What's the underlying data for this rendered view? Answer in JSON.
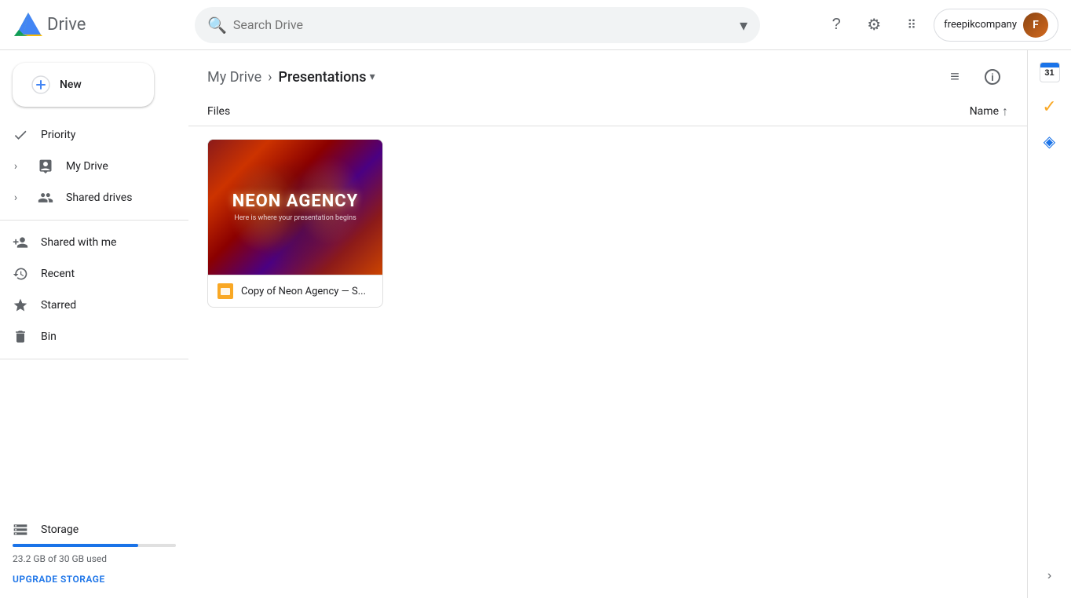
{
  "header": {
    "logo_text": "Drive",
    "search_placeholder": "Search Drive",
    "help_tooltip": "Help",
    "settings_tooltip": "Settings",
    "apps_tooltip": "Google apps",
    "brand_name": "freepikcompany",
    "search_chevron_label": "Advanced search"
  },
  "sidebar": {
    "new_button_label": "New",
    "nav_items": [
      {
        "id": "priority",
        "label": "Priority",
        "icon": "✓",
        "icon_type": "check"
      },
      {
        "id": "my-drive",
        "label": "My Drive",
        "icon": "🗂",
        "has_expand": true
      },
      {
        "id": "shared-drives",
        "label": "Shared drives",
        "icon": "👥",
        "has_expand": true
      },
      {
        "id": "shared-with-me",
        "label": "Shared with me",
        "icon": "👤"
      },
      {
        "id": "recent",
        "label": "Recent",
        "icon": "🕐"
      },
      {
        "id": "starred",
        "label": "Starred",
        "icon": "⭐"
      },
      {
        "id": "bin",
        "label": "Bin",
        "icon": "🗑"
      }
    ],
    "storage": {
      "label": "Storage",
      "used_text": "23.2 GB of 30 GB used",
      "upgrade_label": "UPGRADE STORAGE",
      "fill_percent": 77
    }
  },
  "breadcrumb": {
    "parent": "My Drive",
    "current": "Presentations",
    "chevron": "›"
  },
  "content": {
    "files_label": "Files",
    "sort_label": "Name",
    "sort_direction": "↑",
    "files": [
      {
        "id": "neon-agency",
        "name": "Copy of Neon Agency — S...",
        "type": "slides",
        "thumbnail_title": "NEON AGENCY",
        "thumbnail_subtitle": "Here is where your presentation begins"
      }
    ]
  },
  "right_sidebar": {
    "items": [
      {
        "id": "calendar",
        "label": "Google Calendar",
        "number": "31"
      },
      {
        "id": "tasks",
        "label": "Google Tasks"
      },
      {
        "id": "keep",
        "label": "Google Keep"
      }
    ]
  },
  "expand_arrow": "›"
}
